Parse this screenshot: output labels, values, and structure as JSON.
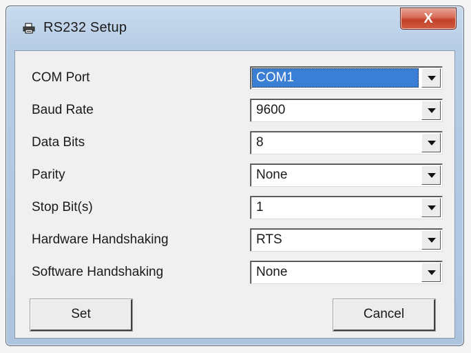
{
  "window": {
    "title": "RS232 Setup",
    "close_label": "X"
  },
  "fields": [
    {
      "label": "COM Port",
      "value": "COM1"
    },
    {
      "label": "Baud Rate",
      "value": "9600"
    },
    {
      "label": "Data Bits",
      "value": "8"
    },
    {
      "label": "Parity",
      "value": "None"
    },
    {
      "label": "Stop Bit(s)",
      "value": "1"
    },
    {
      "label": "Hardware Handshaking",
      "value": "RTS"
    },
    {
      "label": "Software Handshaking",
      "value": "None"
    }
  ],
  "buttons": {
    "set_label": "Set",
    "cancel_label": "Cancel"
  },
  "colors": {
    "selection": "#3a7fd5",
    "close_button": "#c2412a",
    "title_bar": "#b7cde6"
  },
  "icons": {
    "title": "printer-icon",
    "close": "close-icon",
    "dropdown": "chevron-down-icon"
  }
}
